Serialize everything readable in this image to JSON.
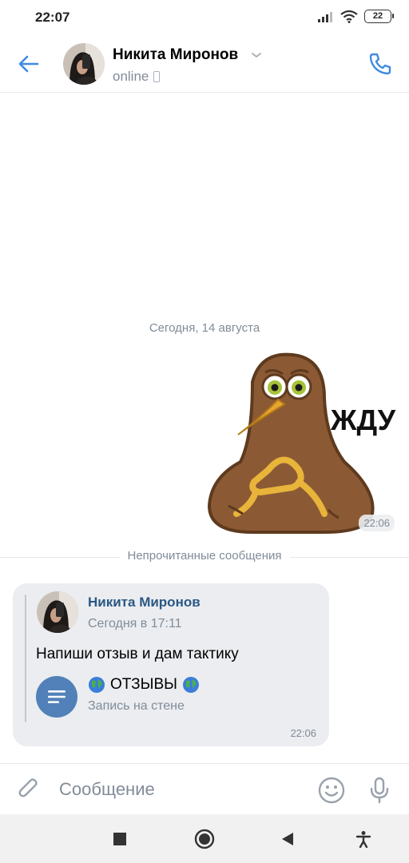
{
  "status_bar": {
    "time": "22:07",
    "battery": "22",
    "icons": [
      "signal-icon",
      "wifi-icon",
      "battery-icon"
    ]
  },
  "header": {
    "name": "Никита Миронов",
    "status": "online",
    "icons": [
      "back-arrow-icon",
      "chevron-down-icon",
      "mobile-phone-icon",
      "phone-call-icon"
    ],
    "accent_color": "#3f8ae0"
  },
  "chat": {
    "date_separator": "Сегодня, 14 августа",
    "sticker": {
      "caption": "ЖДУ",
      "time": "22:06"
    },
    "unread_separator": "Непрочитанные сообщения",
    "message": {
      "forwarded_author": "Никита Миронов",
      "forwarded_time": "Сегодня в 17:11",
      "text": "Напиши отзыв и дам тактику",
      "attachment_title": "ОТЗЫВЫ",
      "attachment_subtitle": "Запись на стене",
      "attachment_icon": "wall-post-icon",
      "time": "22:06"
    }
  },
  "composer": {
    "placeholder": "Сообщение",
    "icons": [
      "paperclip-icon",
      "smiley-icon",
      "microphone-icon"
    ]
  },
  "nav": {
    "icons": [
      "recents-square-icon",
      "home-circle-icon",
      "back-triangle-icon",
      "accessibility-icon"
    ]
  }
}
